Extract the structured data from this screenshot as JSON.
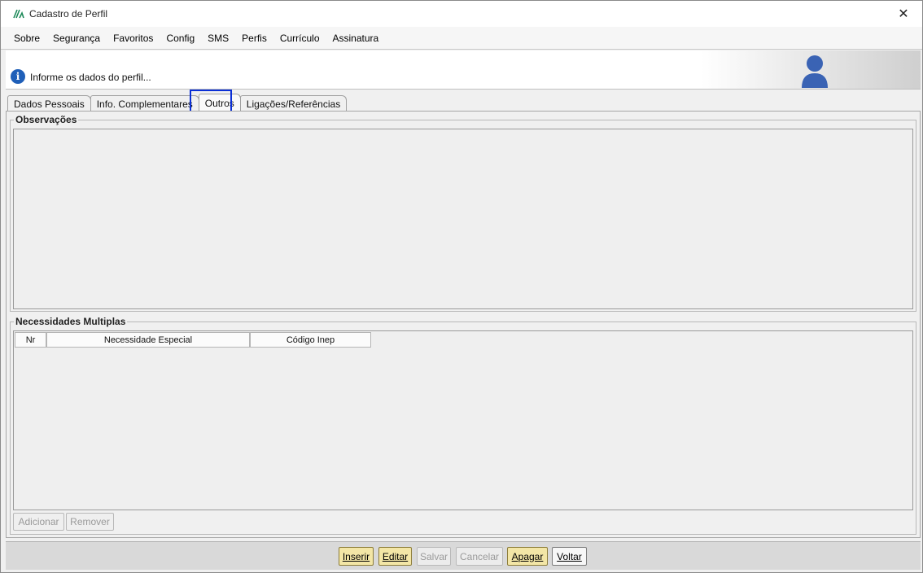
{
  "window": {
    "title": "Cadastro de Perfil"
  },
  "menu": [
    {
      "label": "Sobre"
    },
    {
      "label": "Segurança"
    },
    {
      "label": "Favoritos"
    },
    {
      "label": "Config"
    },
    {
      "label": "SMS"
    },
    {
      "label": "Perfis"
    },
    {
      "label": "Currículo"
    },
    {
      "label": "Assinatura"
    }
  ],
  "info": {
    "text": "Informe os dados do perfil..."
  },
  "tabs": [
    {
      "label": "Dados Pessoais"
    },
    {
      "label": "Info. Complementares"
    },
    {
      "label": "Outros"
    },
    {
      "label": "Ligações/Referências"
    }
  ],
  "active_tab": "Outros",
  "observacoes": {
    "title": "Observações",
    "value": ""
  },
  "necessidades": {
    "title": "Necessidades Multiplas",
    "columns": [
      "Nr",
      "Necessidade Especial",
      "Código Inep"
    ],
    "rows": [],
    "add_label": "Adicionar",
    "remove_label": "Remover"
  },
  "footer": {
    "inserir": "Inserir",
    "editar": "Editar",
    "salvar": "Salvar",
    "cancelar": "Cancelar",
    "apagar": "Apagar",
    "voltar": "Voltar"
  },
  "colors": {
    "highlight": "#0a2fd6",
    "action_button": "#f3e6a6",
    "info_icon": "#1f5fb8",
    "avatar": "#3a63b4"
  }
}
